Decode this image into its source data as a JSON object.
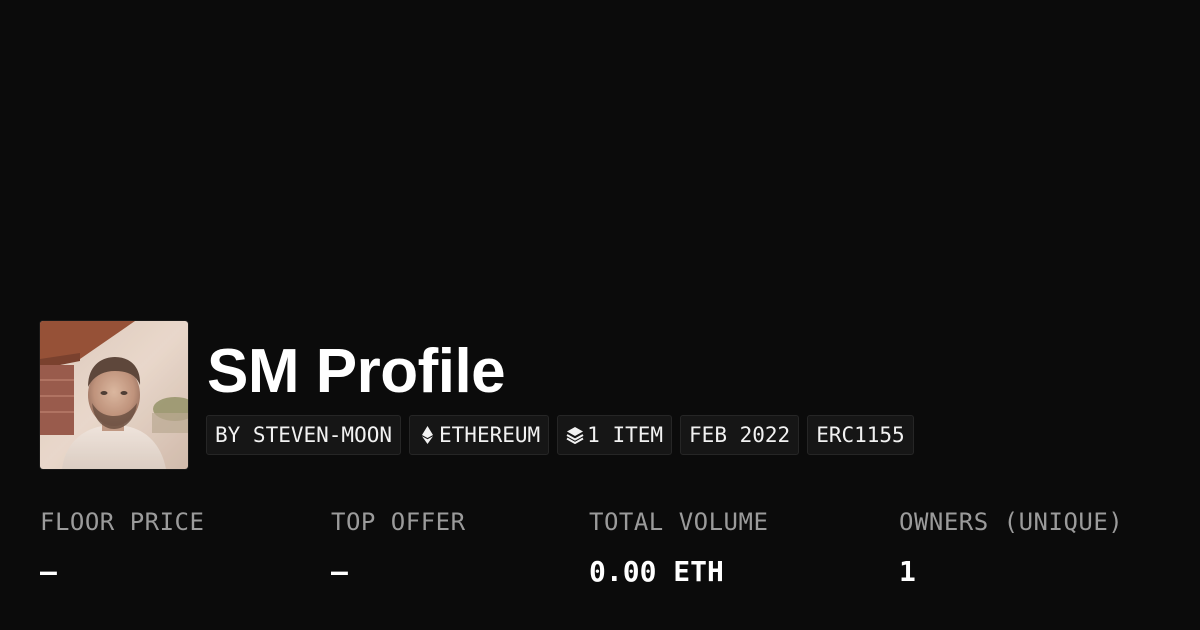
{
  "collection": {
    "title": "SM Profile",
    "avatar_alt": "steven-moon profile photo"
  },
  "tags": [
    {
      "label": "BY STEVEN-MOON",
      "icon": null
    },
    {
      "label": "ETHEREUM",
      "icon": "ethereum-icon"
    },
    {
      "label": "1 ITEM",
      "icon": "layers-icon"
    },
    {
      "label": "FEB 2022",
      "icon": null
    },
    {
      "label": "ERC1155",
      "icon": null
    }
  ],
  "stats": [
    {
      "label": "FLOOR PRICE",
      "value": "—"
    },
    {
      "label": "TOP OFFER",
      "value": "—"
    },
    {
      "label": "TOTAL VOLUME",
      "value": "0.00 ETH"
    },
    {
      "label": "OWNERS (UNIQUE)",
      "value": "1"
    }
  ],
  "colors": {
    "background": "#0b0b0b",
    "tag_background": "#161616",
    "tag_border": "#262626",
    "label_gray": "#9b9b9b",
    "text_white": "#ffffff"
  }
}
